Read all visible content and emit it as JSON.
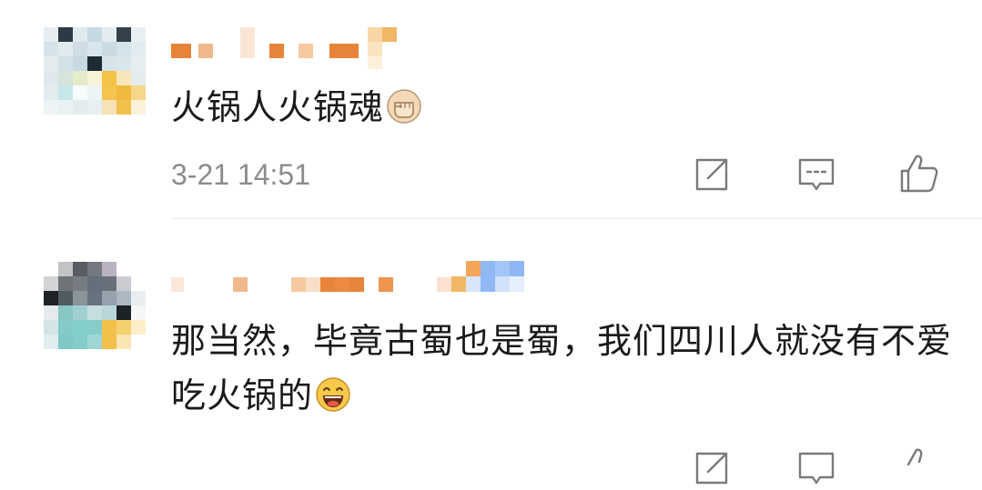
{
  "comments": [
    {
      "text": "火锅人火锅魂",
      "emoji": "fist-emoji",
      "time": "3-21 14:51",
      "actions": [
        "share-icon",
        "comment-icon",
        "like-icon"
      ]
    },
    {
      "text": "那当然，毕竟古蜀也是蜀，我们四川人就没有不爱吃火锅的",
      "emoji": "laughing-emoji"
    }
  ],
  "colors": {
    "text": "#1a1a1a",
    "time": "#8c8c8c",
    "icon": "#7a7a7a",
    "divider": "#e9e9e9",
    "name_orange": "#e8843a",
    "name_light": "#f6c9a0"
  }
}
